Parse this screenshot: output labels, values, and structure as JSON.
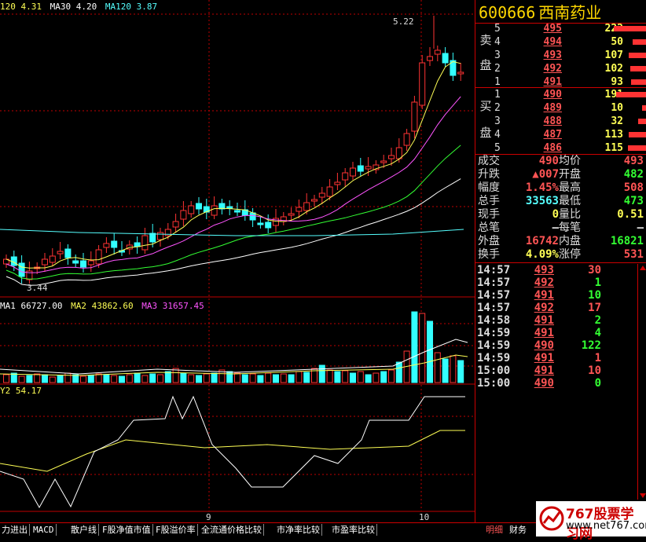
{
  "main_legend": {
    "ma20": "120 4.31",
    "ma30": "MA30 4.20",
    "ma120": "MA120 3.87"
  },
  "annotations": {
    "high_label": "5.22",
    "low_label": "3.44"
  },
  "volume_legend": {
    "ma1": "MA1 66727.00",
    "ma2": "MA2 43862.60",
    "ma3": "MA3 31657.45"
  },
  "indicator_legend": {
    "label": "Y2 54.17"
  },
  "x_ticks": [
    "9",
    "10"
  ],
  "stock": {
    "code": "600666",
    "name": "西南药业"
  },
  "orderbook": {
    "sell_label_1": "卖",
    "sell_label_2": "盘",
    "buy_label_1": "买",
    "buy_label_2": "盘",
    "sell": [
      {
        "level": "5",
        "price": "495",
        "vol": "222",
        "bar": 0.28
      },
      {
        "level": "4",
        "price": "494",
        "vol": "50",
        "bar": 0.12
      },
      {
        "level": "3",
        "price": "493",
        "vol": "107",
        "bar": 0.15
      },
      {
        "level": "2",
        "price": "492",
        "vol": "102",
        "bar": 0.14
      },
      {
        "level": "1",
        "price": "491",
        "vol": "93",
        "bar": 0.13
      }
    ],
    "buy": [
      {
        "level": "1",
        "price": "490",
        "vol": "191",
        "bar": 0.26
      },
      {
        "level": "2",
        "price": "489",
        "vol": "10",
        "bar": 0.04
      },
      {
        "level": "3",
        "price": "488",
        "vol": "32",
        "bar": 0.07
      },
      {
        "level": "4",
        "price": "487",
        "vol": "113",
        "bar": 0.15
      },
      {
        "level": "5",
        "price": "486",
        "vol": "115",
        "bar": 0.16
      }
    ]
  },
  "stats": [
    {
      "l1": "成交",
      "v1": "490",
      "c1": "#ff5555",
      "l2": "均价",
      "v2": "493",
      "c2": "#ff5555"
    },
    {
      "l1": "升跌",
      "v1": "▲007",
      "c1": "#ff5555",
      "l2": "开盘",
      "v2": "482",
      "c2": "#33ff33"
    },
    {
      "l1": "幅度",
      "v1": "1.45%",
      "c1": "#ff5555",
      "l2": "最高",
      "v2": "508",
      "c2": "#ff5555"
    },
    {
      "l1": "总手",
      "v1": "33563",
      "c1": "#55ffff",
      "l2": "最低",
      "v2": "473",
      "c2": "#33ff33"
    },
    {
      "l1": "现手",
      "v1": "0",
      "c1": "#ffff55",
      "l2": "量比",
      "v2": "0.51",
      "c2": "#ffff55"
    },
    {
      "l1": "总笔",
      "v1": "—",
      "c1": "#ddd",
      "l2": "每笔",
      "v2": "—",
      "c2": "#ddd"
    },
    {
      "l1": "外盘",
      "v1": "16742",
      "c1": "#ff5555",
      "l2": "内盘",
      "v2": "16821",
      "c2": "#33ff33"
    },
    {
      "l1": "换手",
      "v1": "4.09%",
      "c1": "#ffff55",
      "l2": "涨停",
      "v2": "531",
      "c2": "#ff5555"
    }
  ],
  "ticks": [
    {
      "time": "14:57",
      "price": "493",
      "vol": "30",
      "pc": "#ff5555",
      "vc": "#ff5555"
    },
    {
      "time": "14:57",
      "price": "492",
      "vol": "1",
      "pc": "#ff5555",
      "vc": "#33ff33"
    },
    {
      "time": "14:57",
      "price": "491",
      "vol": "10",
      "pc": "#ff5555",
      "vc": "#33ff33"
    },
    {
      "time": "14:57",
      "price": "492",
      "vol": "17",
      "pc": "#ff5555",
      "vc": "#ff5555"
    },
    {
      "time": "14:58",
      "price": "491",
      "vol": "2",
      "pc": "#ff5555",
      "vc": "#33ff33"
    },
    {
      "time": "14:59",
      "price": "491",
      "vol": "4",
      "pc": "#ff5555",
      "vc": "#33ff33"
    },
    {
      "time": "14:59",
      "price": "490",
      "vol": "122",
      "pc": "#ff5555",
      "vc": "#33ff33"
    },
    {
      "time": "14:59",
      "price": "491",
      "vol": "1",
      "pc": "#ff5555",
      "vc": "#ff5555"
    },
    {
      "time": "15:00",
      "price": "491",
      "vol": "10",
      "pc": "#ff5555",
      "vc": "#ff5555"
    },
    {
      "time": "15:00",
      "price": "490",
      "vol": "0",
      "pc": "#ff5555",
      "vc": "#33ff33"
    }
  ],
  "tabs": [
    "力进出",
    "MACD",
    "散户线",
    "F股净值市值",
    "F股溢价率",
    "全流通价格比较",
    "市净率比较",
    "市盈率比较"
  ],
  "right_tabs": {
    "detail": "明细",
    "finance": "财务"
  },
  "watermark": {
    "line1": "767股票学习网",
    "line2": "www.net767.com"
  },
  "colors": {
    "up": "#ff3333",
    "down": "#33ffff",
    "grid": "#c00000"
  }
}
